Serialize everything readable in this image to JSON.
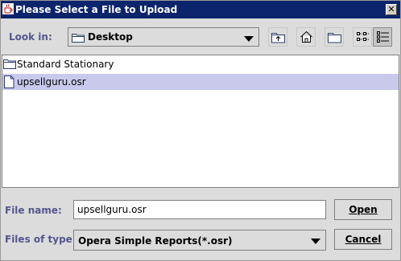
{
  "window": {
    "title": "Please Select a File to Upload",
    "close_glyph": "✕"
  },
  "look_in": {
    "label": "Look in:",
    "value": "Desktop"
  },
  "toolbar": {
    "up_icon": "up-folder-icon",
    "home_icon": "home-icon",
    "new_folder_icon": "new-folder-icon",
    "list_view_icon": "list-view-icon",
    "details_view_icon": "details-view-icon"
  },
  "files": [
    {
      "name": "Standard Stationary",
      "type": "folder",
      "selected": false
    },
    {
      "name": "upsellguru.osr",
      "type": "file",
      "selected": true
    }
  ],
  "file_name": {
    "label": "File name:",
    "value": "upsellguru.osr"
  },
  "file_type": {
    "label": "Files of type:",
    "value": "Opera Simple Reports(*.osr)"
  },
  "buttons": {
    "open": "Open",
    "cancel": "Cancel"
  },
  "colors": {
    "titlebar": "#0b246b",
    "label": "#56568e",
    "selection": "#c9c9ec"
  }
}
